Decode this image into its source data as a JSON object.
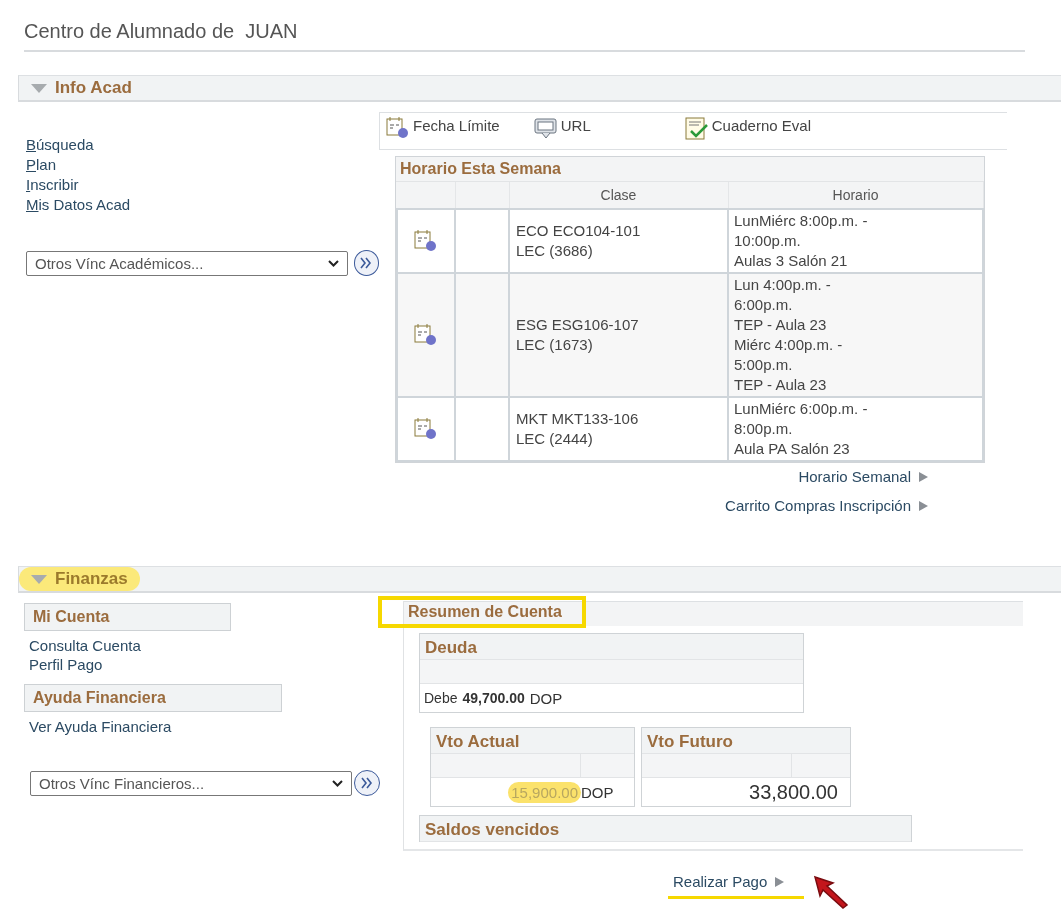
{
  "page_title": "Centro de Alumnado de  JUAN",
  "info_acad": {
    "title": "Info Acad",
    "expanded": true,
    "highlighted": false,
    "links": [
      "Búsqueda",
      "Plan",
      "Inscribir",
      "Mis Datos Acad"
    ],
    "dropdown": {
      "value": "Otros Vínc Académicos..."
    },
    "toolbar": [
      {
        "kind": "deadline",
        "label": "Fecha Límite"
      },
      {
        "kind": "url",
        "label": "URL"
      },
      {
        "kind": "gradebook",
        "label": "Cuaderno Eval"
      }
    ],
    "schedule": {
      "title": "Horario Esta Semana",
      "columns": [
        "Clase",
        "Horario"
      ],
      "rows": [
        {
          "clase": "ECO ECO104-101\nLEC (3686)",
          "horario": "LunMiérc 8:00p.m. -\n10:00p.m.\nAulas 3 Salón 21"
        },
        {
          "clase": "ESG ESG106-107\nLEC (1673)",
          "horario": "Lun 4:00p.m. -\n6:00p.m.\nTEP - Aula 23\nMiérc 4:00p.m. -\n5:00p.m.\nTEP - Aula 23"
        },
        {
          "clase": "MKT MKT133-106\nLEC (2444)",
          "horario": "LunMiérc 6:00p.m. -\n8:00p.m.\nAula PA Salón 23"
        }
      ]
    },
    "footer_links": [
      "Horario Semanal",
      "Carrito Compras Inscripción"
    ]
  },
  "finanzas": {
    "title": "Finanzas",
    "expanded": true,
    "highlighted": true,
    "groups": [
      {
        "title": "Mi Cuenta",
        "links": [
          "Consulta Cuenta",
          "Perfil Pago"
        ]
      },
      {
        "title": "Ayuda Financiera",
        "links": [
          "Ver Ayuda Financiera"
        ]
      }
    ],
    "dropdown": {
      "value": "Otros Vínc Financieros..."
    },
    "summary": {
      "title": "Resumen de Cuenta",
      "boxed": true,
      "deuda": {
        "title": "Deuda",
        "label": "Debe",
        "amount": "49,700.00",
        "currency": "DOP"
      },
      "vto_actual": {
        "title": "Vto Actual",
        "amount": "15,900.00",
        "currency": "DOP",
        "highlighted": true
      },
      "vto_futuro": {
        "title": "Vto Futuro",
        "amount": "33,800.00"
      },
      "saldos": {
        "title": "Saldos vencidos"
      }
    },
    "pay_link": {
      "label": "Realizar Pago",
      "underlined": true
    }
  }
}
